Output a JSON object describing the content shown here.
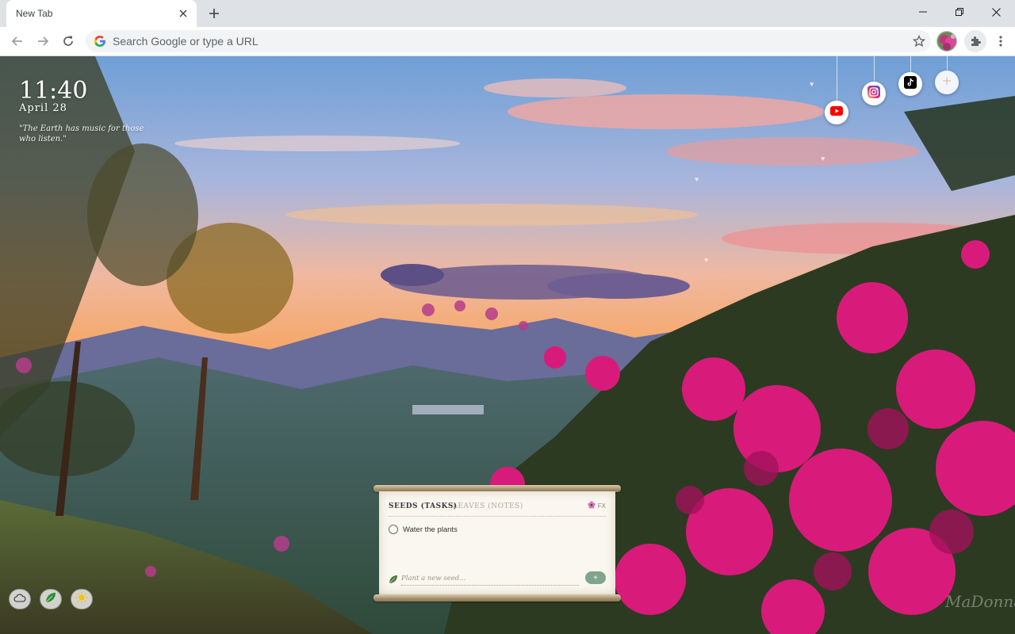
{
  "browser": {
    "tab_title": "New Tab",
    "omnibox_placeholder": "Search Google or type a URL"
  },
  "clock": {
    "time": "11:40",
    "date": "April 28",
    "quote": "\"The Earth has music for those who listen.\""
  },
  "social_links": [
    {
      "name": "YouTube",
      "icon": "youtube-icon",
      "color": "#ff0000"
    },
    {
      "name": "Instagram",
      "icon": "instagram-icon",
      "color": "#d62976"
    },
    {
      "name": "TikTok",
      "icon": "tiktok-icon",
      "color": "#000000"
    },
    {
      "name": "Add shortcut",
      "icon": "plus-icon",
      "color": "#e8b9a8"
    }
  ],
  "task_widget": {
    "tab_tasks": "SEEDS (TASKS)",
    "tab_notes": "LEAVES (NOTES)",
    "fx_label": "FX",
    "tasks": [
      {
        "label": "Water the plants",
        "done": false
      }
    ],
    "new_task_placeholder": "Plant a new seed...",
    "add_label": "+"
  },
  "bottom_toggles": [
    "cloud-icon",
    "leaf-icon",
    "sun-icon"
  ],
  "signature": "MaDonna",
  "colors": {
    "chrome_bg": "#dee1e6",
    "accent_green": "#7fa58d",
    "flower_magenta": "#d81b7a"
  }
}
